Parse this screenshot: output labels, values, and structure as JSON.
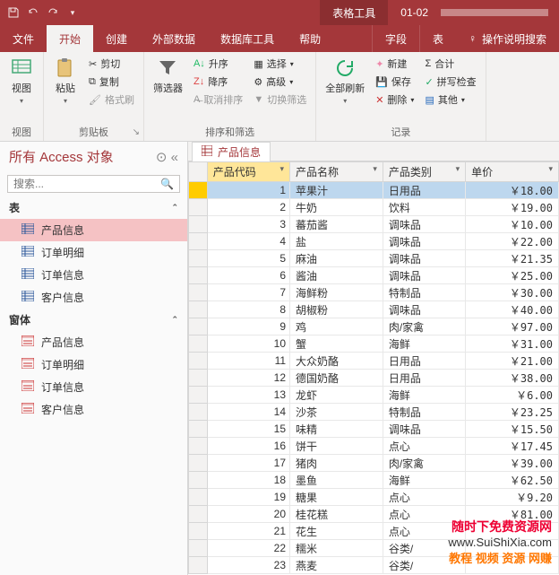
{
  "titlebar": {
    "context_tab": "表格工具",
    "filename": "01-02"
  },
  "tabs": {
    "file": "文件",
    "home": "开始",
    "create": "创建",
    "external": "外部数据",
    "dbtools": "数据库工具",
    "help": "帮助",
    "fields": "字段",
    "table": "表",
    "tellme": "操作说明搜索"
  },
  "ribbon": {
    "view": "视图",
    "paste": "粘贴",
    "cut": "剪切",
    "copy": "复制",
    "format_painter": "格式刷",
    "clipboard": "剪贴板",
    "filter": "筛选器",
    "asc": "升序",
    "desc": "降序",
    "clear_sort": "取消排序",
    "selection": "选择",
    "advanced": "高级",
    "toggle_filter": "切换筛选",
    "sort_filter": "排序和筛选",
    "refresh_all": "全部刷新",
    "new": "新建",
    "save": "保存",
    "delete": "删除",
    "totals": "合计",
    "spelling": "拼写检查",
    "more": "其他",
    "records": "记录"
  },
  "nav": {
    "header": "所有 Access 对象",
    "search_placeholder": "搜索...",
    "section_tables": "表",
    "section_forms": "窗体",
    "tables": [
      {
        "label": "产品信息"
      },
      {
        "label": "订单明细"
      },
      {
        "label": "订单信息"
      },
      {
        "label": "客户信息"
      }
    ],
    "forms": [
      {
        "label": "产品信息"
      },
      {
        "label": "订单明细"
      },
      {
        "label": "订单信息"
      },
      {
        "label": "客户信息"
      }
    ]
  },
  "doc_tab": "产品信息",
  "columns": {
    "id": "产品代码",
    "name": "产品名称",
    "category": "产品类别",
    "price": "单价"
  },
  "rows": [
    {
      "id": 1,
      "name": "苹果汁",
      "category": "日用品",
      "price": "￥18.00"
    },
    {
      "id": 2,
      "name": "牛奶",
      "category": "饮料",
      "price": "￥19.00"
    },
    {
      "id": 3,
      "name": "蕃茄酱",
      "category": "调味品",
      "price": "￥10.00"
    },
    {
      "id": 4,
      "name": "盐",
      "category": "调味品",
      "price": "￥22.00"
    },
    {
      "id": 5,
      "name": "麻油",
      "category": "调味品",
      "price": "￥21.35"
    },
    {
      "id": 6,
      "name": "酱油",
      "category": "调味品",
      "price": "￥25.00"
    },
    {
      "id": 7,
      "name": "海鲜粉",
      "category": "特制品",
      "price": "￥30.00"
    },
    {
      "id": 8,
      "name": "胡椒粉",
      "category": "调味品",
      "price": "￥40.00"
    },
    {
      "id": 9,
      "name": "鸡",
      "category": "肉/家禽",
      "price": "￥97.00"
    },
    {
      "id": 10,
      "name": "蟹",
      "category": "海鲜",
      "price": "￥31.00"
    },
    {
      "id": 11,
      "name": "大众奶酪",
      "category": "日用品",
      "price": "￥21.00"
    },
    {
      "id": 12,
      "name": "德国奶酪",
      "category": "日用品",
      "price": "￥38.00"
    },
    {
      "id": 13,
      "name": "龙虾",
      "category": "海鲜",
      "price": "￥6.00"
    },
    {
      "id": 14,
      "name": "沙茶",
      "category": "特制品",
      "price": "￥23.25"
    },
    {
      "id": 15,
      "name": "味精",
      "category": "调味品",
      "price": "￥15.50"
    },
    {
      "id": 16,
      "name": "饼干",
      "category": "点心",
      "price": "￥17.45"
    },
    {
      "id": 17,
      "name": "猪肉",
      "category": "肉/家禽",
      "price": "￥39.00"
    },
    {
      "id": 18,
      "name": "墨鱼",
      "category": "海鲜",
      "price": "￥62.50"
    },
    {
      "id": 19,
      "name": "糖果",
      "category": "点心",
      "price": "￥9.20"
    },
    {
      "id": 20,
      "name": "桂花糕",
      "category": "点心",
      "price": "￥81.00"
    },
    {
      "id": 21,
      "name": "花生",
      "category": "点心",
      "price": ""
    },
    {
      "id": 22,
      "name": "糯米",
      "category": "谷类/",
      "price": ""
    },
    {
      "id": 23,
      "name": "燕麦",
      "category": "谷类/",
      "price": ""
    }
  ],
  "watermark": {
    "line1": "随时下免费资源网",
    "line2": "www.SuiShiXia.com",
    "line3": "教程 视频 资源 网赚"
  }
}
